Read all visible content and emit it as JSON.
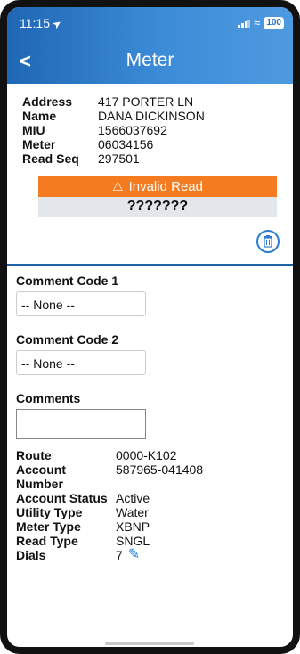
{
  "status": {
    "time": "11:15",
    "battery": "100"
  },
  "nav": {
    "back": "<",
    "title": "Meter"
  },
  "meter": {
    "address_label": "Address",
    "address": "417 PORTER LN",
    "name_label": "Name",
    "name": "DANA DICKINSON",
    "miu_label": "MIU",
    "miu": "1566037692",
    "meter_label": "Meter",
    "meter": "06034156",
    "readseq_label": "Read Seq",
    "readseq": "297501",
    "warning": "Invalid Read",
    "read_value": "???????"
  },
  "form": {
    "comment1_label": "Comment Code 1",
    "comment1_value": "-- None --",
    "comment2_label": "Comment Code 2",
    "comment2_value": "-- None --",
    "comments_label": "Comments",
    "comments_value": ""
  },
  "details": [
    {
      "label": "Route",
      "value": "0000-K102"
    },
    {
      "label": "Account Number",
      "value": "587965-041408"
    },
    {
      "label": "Account Status",
      "value": "Active"
    },
    {
      "label": "Utility Type",
      "value": "Water"
    },
    {
      "label": "Meter Type",
      "value": "XBNP"
    },
    {
      "label": "Read Type",
      "value": "SNGL"
    },
    {
      "label": "Dials",
      "value": "7"
    }
  ],
  "colors": {
    "header": "#2a70b8",
    "warning": "#f47b20",
    "accent": "#1f7ee0"
  }
}
